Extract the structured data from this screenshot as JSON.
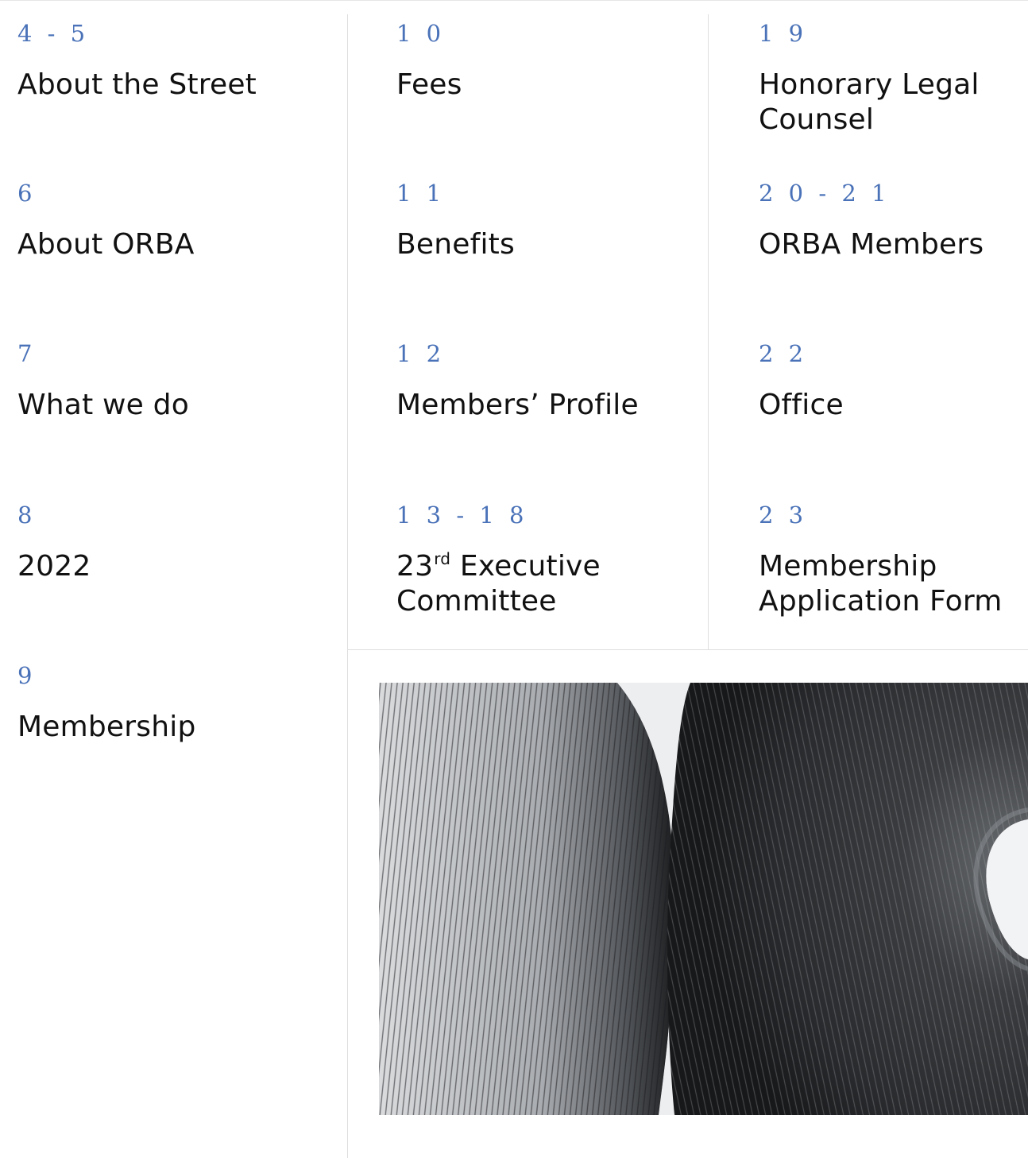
{
  "toc": {
    "columns": [
      [
        {
          "page": "4 - 5",
          "title": "About the Street"
        },
        {
          "page": "6",
          "title": "About ORBA"
        },
        {
          "page": "7",
          "title": "What we do"
        },
        {
          "page": "8",
          "title": "2022"
        },
        {
          "page": "9",
          "title": "Membership"
        }
      ],
      [
        {
          "page": "1 0",
          "title": "Fees"
        },
        {
          "page": "1 1",
          "title": "Benefits"
        },
        {
          "page": "1 2",
          "title": "Members’ Profile"
        },
        {
          "page": "1 3 - 1 8",
          "title_line1_num": "23",
          "title_line1_sup": "rd",
          "title_line1_rest": " Executive",
          "title_line2": "Committee"
        }
      ],
      [
        {
          "page": "1 9",
          "title_line1": "Honorary Legal",
          "title_line2": "Counsel"
        },
        {
          "page": "2 0 - 2 1",
          "title": "ORBA Members"
        },
        {
          "page": "2 2",
          "title": "Office"
        },
        {
          "page": "2 3",
          "title_line1": "Membership",
          "title_line2": "Application Form"
        }
      ]
    ]
  },
  "colors": {
    "page_number": "#4a72b8",
    "text": "#111111",
    "rule": "#dedede"
  }
}
